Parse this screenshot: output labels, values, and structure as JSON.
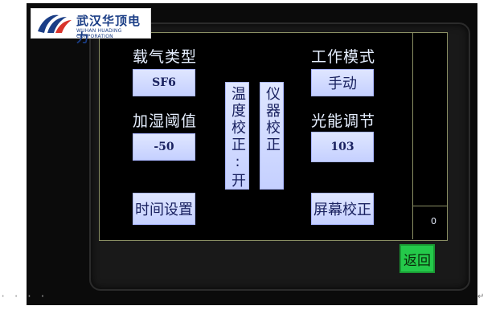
{
  "logo": {
    "company_cn": "武汉华顶电力",
    "company_en": "WUHAN HUADING CORPORATION"
  },
  "screen": {
    "carrier_gas": {
      "label": "载气类型",
      "value": "SF6"
    },
    "humidify_threshold": {
      "label": "加湿阈值",
      "value": "-50"
    },
    "work_mode": {
      "label": "工作模式",
      "value": "手动"
    },
    "light_adjust": {
      "label": "光能调节",
      "value": "103"
    },
    "temp_calibration": "温度校正:开",
    "instrument_calibration": "仪器校正",
    "time_settings": "时间设置",
    "screen_calibration": "屏幕校正",
    "side_value": "0",
    "back": "返回"
  },
  "artifacts": {
    "left_dots": "· · · ·",
    "return_mark": "↵"
  },
  "colors": {
    "device_bg": "#0b0b0b",
    "button_bg": "#c5d0ff",
    "label_text": "#e6efff",
    "back_button": "#24c94a",
    "logo_blue": "#1b3e86",
    "logo_red": "#d8332b"
  }
}
